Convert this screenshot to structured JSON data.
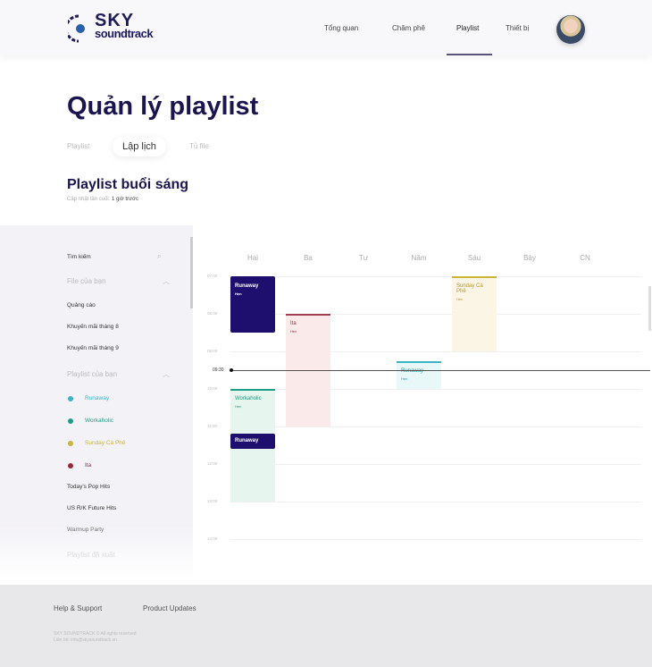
{
  "header": {
    "logo_top": "SKY",
    "logo_bottom": "soundtrack",
    "nav": [
      "Tổng quan",
      "Chăm phê",
      "Playlist",
      "Thiết bị"
    ],
    "active_nav": "Playlist"
  },
  "page": {
    "title": "Quản lý playlist",
    "tabs": [
      "Playlist",
      "Lập lịch",
      "Tủ file"
    ],
    "active_tab": "Lập lịch",
    "subtitle": "Playlist buổi sáng",
    "caption_label": "Cập nhật lần cuối:",
    "caption_value": "1 giờ trước"
  },
  "sidebar": {
    "search_placeholder": "Tìm kiếm",
    "files_heading": "File của bạn",
    "files": [
      "Quảng cáo",
      "Khuyến mãi tháng 8",
      "Khuyến mãi tháng 9"
    ],
    "playlists_heading": "Playlist của bạn",
    "playlists": [
      {
        "label": "Runaway",
        "color": "#3bb5c4"
      },
      {
        "label": "Workaholic",
        "color": "#1e9e84"
      },
      {
        "label": "Sunday Cà Phê",
        "color": "#c9b53a"
      },
      {
        "label": "Ita",
        "color": "#9a2a3a"
      }
    ],
    "other_playlists": [
      "Today's Pop Hits",
      "US R/K Future Hits",
      "Warmup Party"
    ],
    "next_heading": "Playlist đã xuất"
  },
  "calendar": {
    "days": [
      "Hai",
      "Ba",
      "Tư",
      "Năm",
      "Sáu",
      "Bảy",
      "CN"
    ],
    "hours": [
      "07:00",
      "08:00",
      "09:00",
      "10:00",
      "11:00",
      "12:00",
      "13:00",
      "14:00"
    ],
    "now": "09:30",
    "events": [
      {
        "title": "Runaway",
        "sub": "Hẹn",
        "day": "Hai",
        "bg": "#1e0f6e",
        "fg": "#ffffff",
        "bar": "#1e0f6e"
      },
      {
        "title": "Ita",
        "sub": "Hẹn",
        "day": "Ba",
        "bg": "#fbeaea",
        "fg": "#9a2a3a",
        "bar": "#a04050"
      },
      {
        "title": "Sunday Cà Phê",
        "sub": "Hẹn",
        "day": "Sáu",
        "bg": "#fbf5e6",
        "fg": "#b8962a",
        "bar": "#c9b53a"
      },
      {
        "title": "Runaway",
        "sub": "Hẹn",
        "day": "Năm",
        "bg": "#e8f7f8",
        "fg": "#2a9aa8",
        "bar": "#3bb5c4"
      },
      {
        "title": "Workaholic",
        "sub": "Hẹn",
        "day": "Hai",
        "bg": "#e6f6ef",
        "fg": "#1e9e84",
        "bar": "#1e9e84"
      },
      {
        "title": "Runaway",
        "sub": "",
        "day": "Hai",
        "bg": "#1e0f6e",
        "fg": "#ffffff",
        "bar": "#1e0f6e"
      }
    ]
  },
  "footer": {
    "links": [
      "Help & Support",
      "Product Updates"
    ],
    "line1": "SKY SOUNDTRACK © All rights reserved",
    "line2": "Liên hệ: info@skysoundtrack.vn"
  }
}
